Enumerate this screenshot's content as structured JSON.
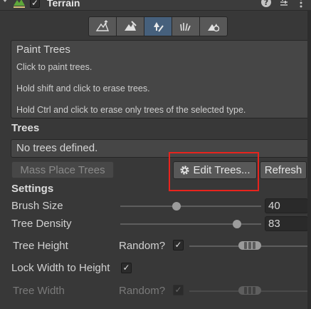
{
  "header": {
    "title": "Terrain"
  },
  "tools": [
    {
      "name": "raise-lower-terrain-icon",
      "active": false
    },
    {
      "name": "paint-texture-icon",
      "active": false
    },
    {
      "name": "paint-trees-icon",
      "active": true
    },
    {
      "name": "paint-details-icon",
      "active": false
    },
    {
      "name": "terrain-settings-icon",
      "active": false
    }
  ],
  "help": {
    "title": "Paint Trees",
    "line1": "Click to paint trees.",
    "line2": "Hold shift and click to erase trees.",
    "line3": "Hold Ctrl and click to erase only trees of the selected type."
  },
  "trees": {
    "section": "Trees",
    "empty_text": "No trees defined.",
    "mass_place_label": "Mass Place Trees",
    "edit_label": "Edit Trees...",
    "refresh_label": "Refresh"
  },
  "settings": {
    "section": "Settings",
    "brush_size_label": "Brush Size",
    "brush_size_value": "40",
    "brush_size_fraction": 0.4,
    "tree_density_label": "Tree Density",
    "tree_density_value": "83",
    "tree_density_fraction": 0.83,
    "tree_height_label": "Tree Height",
    "random_label": "Random?",
    "lock_width_label": "Lock Width to Height",
    "tree_width_label": "Tree Width",
    "random_label_2": "Random?"
  },
  "colors": {
    "accent": "#46607c",
    "highlight": "#e8231d"
  }
}
